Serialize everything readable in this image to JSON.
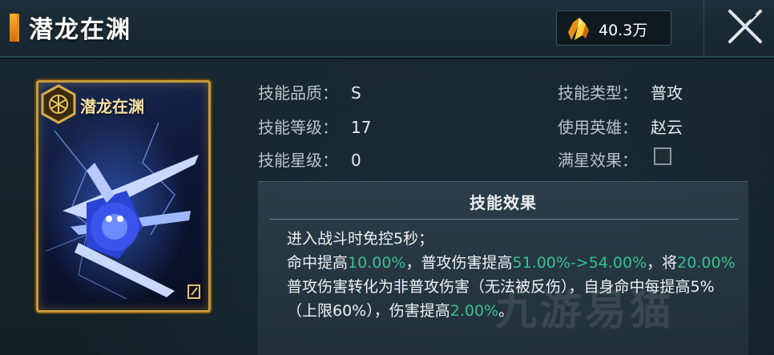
{
  "header": {
    "title": "潜龙在渊",
    "currency_amount": "40.3万"
  },
  "card": {
    "name": "潜龙在渊"
  },
  "stats": {
    "quality_label": "技能品质：",
    "quality_value": "S",
    "level_label": "技能等级：",
    "level_value": "17",
    "star_label": "技能星级：",
    "star_value": "0",
    "type_label": "技能类型：",
    "type_value": "普攻",
    "hero_label": "使用英雄：",
    "hero_value": "赵云",
    "fullstar_label": "满星效果：",
    "fullstar_checked": false
  },
  "effect": {
    "title": "技能效果",
    "line1": "进入战斗时免控5秒；",
    "seg1": "命中提高",
    "hit_bonus": "10.00%",
    "seg2": "，普攻伤害提高",
    "dmg_bonus": "51.00%->54.00%",
    "seg3": "，将",
    "convert_pct": "20.00%",
    "seg4": "普攻伤害转化为非普攻伤害（无法被反伤），自身命中每提高5%（上限60%），伤害提高",
    "per_bonus": "2.00%",
    "seg5": "。"
  },
  "watermark": "九游易猫",
  "colors": {
    "highlight": "#38c28f",
    "card_border": "#c89a3a",
    "accent": "#e08a1a"
  }
}
